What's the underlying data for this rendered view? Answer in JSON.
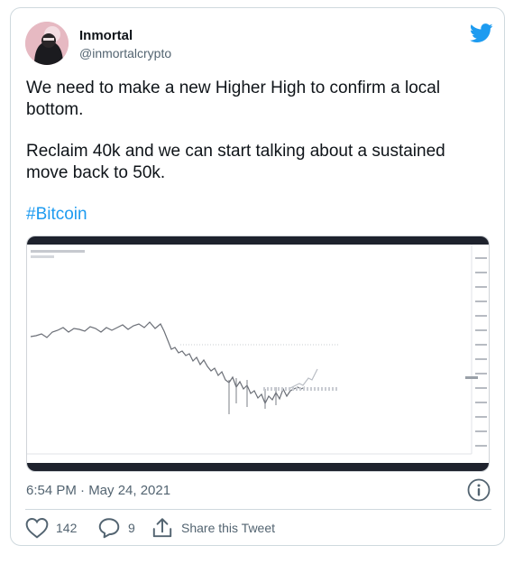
{
  "tweet": {
    "display_name": "Inmortal",
    "handle": "@inmortalcrypto",
    "paragraph_1": "We need to make a new Higher High to confirm a local bottom.",
    "paragraph_2": "Reclaim 40k and we can start talking about a sustained move back to 50k.",
    "hashtag": "#Bitcoin",
    "timestamp": "6:54 PM · May 24, 2021"
  },
  "actions": {
    "like_count": "142",
    "reply_count": "9",
    "share_label": "Share this Tweet"
  },
  "icons": {
    "logo": "twitter-bird-icon",
    "info": "info-icon",
    "like": "heart-icon",
    "reply": "reply-bubble-icon",
    "share": "share-arrow-icon"
  },
  "colors": {
    "accent": "#1d9bf0",
    "text": "#0f1419",
    "muted": "#536471",
    "border": "#cfd9de",
    "chart_bar": "#1e222d"
  }
}
